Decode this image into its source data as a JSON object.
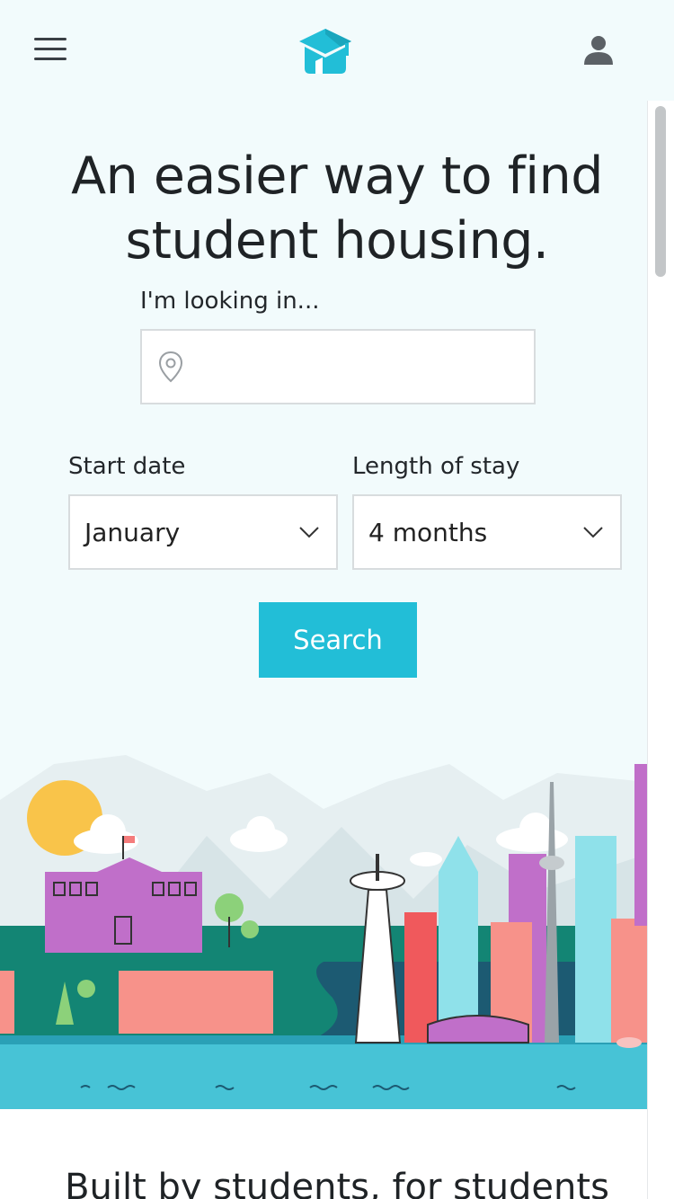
{
  "header": {
    "menu_icon": "hamburger-menu-icon",
    "logo_icon": "graduation-cap-house-logo",
    "user_icon": "user-account-icon"
  },
  "hero": {
    "title_line1": "An easier way to find",
    "title_line2": "student housing."
  },
  "search": {
    "location_label": "I'm looking in...",
    "location_value": "",
    "location_placeholder": "",
    "start_date_label": "Start date",
    "start_date_value": "January",
    "length_label": "Length of stay",
    "length_value": "4 months",
    "button_label": "Search"
  },
  "section": {
    "title": "Built by students, for students"
  },
  "colors": {
    "accent": "#22bed7",
    "background": "#f2fbfc"
  }
}
